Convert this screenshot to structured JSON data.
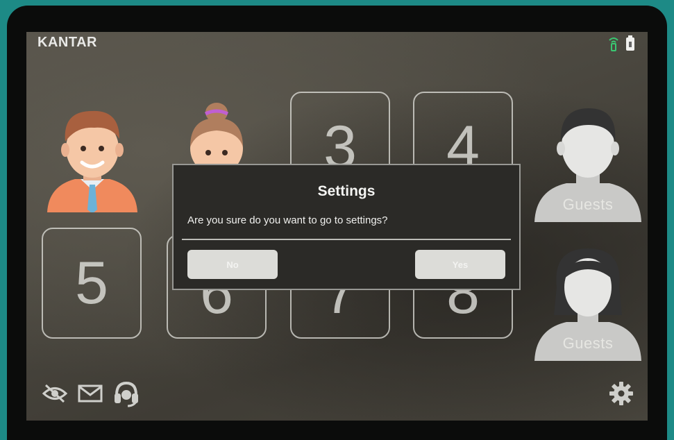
{
  "brand": "KANTAR",
  "tiles": [
    "3",
    "4",
    "5",
    "6",
    "7",
    "8"
  ],
  "guests": [
    "Guests",
    "Guests"
  ],
  "dialog": {
    "title": "Settings",
    "message": "Are you sure do you want to go to settings?",
    "no_label": "No",
    "yes_label": "Yes"
  },
  "icons": {
    "status": [
      "signal-icon",
      "battery-icon"
    ],
    "bottom": [
      "eye-off-icon",
      "mail-icon",
      "headset-icon"
    ],
    "settings": "gear-icon"
  },
  "colors": {
    "accent_signal": "#39c872",
    "background": "#1d8a86"
  }
}
